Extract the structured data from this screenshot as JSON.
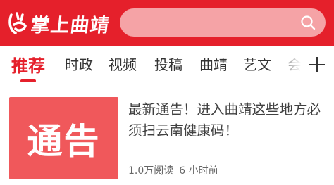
{
  "header": {
    "logo_text": "掌上曲靖",
    "search_icon": "search-icon",
    "colors": {
      "brand": "#e5202b",
      "search_bg": "#f5a3a6"
    }
  },
  "tabs": {
    "items": [
      {
        "label": "推荐",
        "active": true
      },
      {
        "label": "时政",
        "active": false
      },
      {
        "label": "视频",
        "active": false
      },
      {
        "label": "投稿",
        "active": false
      },
      {
        "label": "曲靖",
        "active": false
      },
      {
        "label": "艺文",
        "active": false
      },
      {
        "label": "会",
        "active": false
      }
    ],
    "more_icon": "plus-icon"
  },
  "article": {
    "thumb_text": "通告",
    "thumb_color": "#f0585b",
    "title": "最新通告！进入曲靖这些地方必须扫云南健康码！",
    "views": "1.0万阅读",
    "time": "6 小时前"
  }
}
